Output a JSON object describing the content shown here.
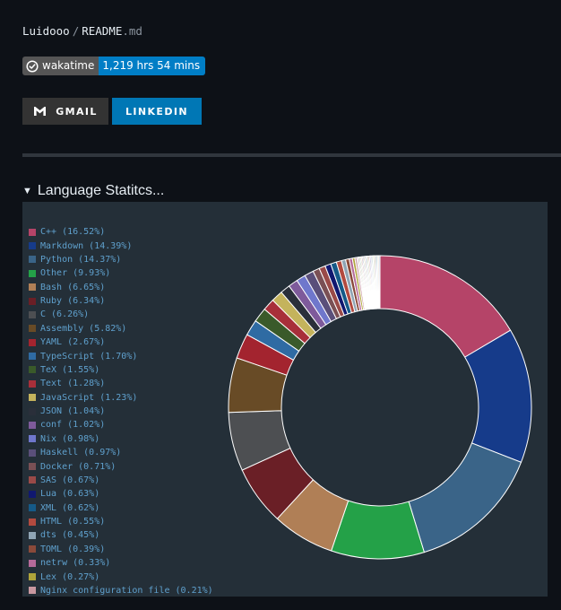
{
  "breadcrumb": {
    "owner": "Luidooo",
    "separator": "/",
    "file_name": "README",
    "file_ext": ".md"
  },
  "badge": {
    "label": "wakatime",
    "value": "1,219 hrs 54 mins",
    "icon": "wakatime-clock-icon",
    "label_color": "#555555",
    "value_color": "#007ec6"
  },
  "buttons": {
    "gmail": {
      "label": "GMAIL",
      "icon": "gmail-icon",
      "color": "#333333"
    },
    "linkedin": {
      "label": "LINKEDIN",
      "color": "#0077b5"
    }
  },
  "section": {
    "title": "Language Statitcs...",
    "toggle_icon": "triangle-down-icon"
  },
  "chart_data": {
    "type": "pie",
    "donut": true,
    "legend_position": "left",
    "categories": [
      "C++",
      "Markdown",
      "Python",
      "Other",
      "Bash",
      "Ruby",
      "C",
      "Assembly",
      "YAML",
      "TypeScript",
      "TeX",
      "Text",
      "JavaScript",
      "JSON",
      "conf",
      "Nix",
      "Haskell",
      "Docker",
      "SAS",
      "Lua",
      "XML",
      "HTML",
      "dts",
      "TOML",
      "netrw",
      "Lex",
      "Nginx configuration file"
    ],
    "values": [
      16.52,
      14.39,
      14.37,
      9.93,
      6.65,
      6.34,
      6.26,
      5.82,
      2.67,
      1.7,
      1.55,
      1.28,
      1.23,
      1.04,
      1.02,
      0.98,
      0.97,
      0.71,
      0.67,
      0.63,
      0.62,
      0.55,
      0.45,
      0.39,
      0.33,
      0.27,
      0.21
    ],
    "legend_labels": [
      "C++ (16.52%)",
      "Markdown (14.39%)",
      "Python (14.37%)",
      "Other (9.93%)",
      "Bash (6.65%)",
      "Ruby (6.34%)",
      "C (6.26%)",
      "Assembly (5.82%)",
      "YAML (2.67%)",
      "TypeScript (1.70%)",
      "TeX (1.55%)",
      "Text (1.28%)",
      "JavaScript (1.23%)",
      "JSON (1.04%)",
      "conf (1.02%)",
      "Nix (0.98%)",
      "Haskell (0.97%)",
      "Docker (0.71%)",
      "SAS (0.67%)",
      "Lua (0.63%)",
      "XML (0.62%)",
      "HTML (0.55%)",
      "dts (0.45%)",
      "TOML (0.39%)",
      "netrw (0.33%)",
      "Lex (0.27%)",
      "Nginx configuration file (0.21%)"
    ],
    "colors": [
      "#b54468",
      "#163b8a",
      "#3a6488",
      "#24a148",
      "#b07f56",
      "#6a1f26",
      "#4d4f52",
      "#684b26",
      "#a3242f",
      "#2f6ba3",
      "#3a5a2a",
      "#a82f3a",
      "#c4b35c",
      "#2a2f3a",
      "#7e5a9b",
      "#6f77cc",
      "#5a4f7a",
      "#7a5055",
      "#9a4a48",
      "#101870",
      "#155a88",
      "#b24a3f",
      "#8fa4b4",
      "#8a4a3a",
      "#b56a9a",
      "#b0a43a",
      "#c898a0"
    ],
    "tail_colors": [
      "#7a5a9a",
      "#9a7a3a",
      "#5a8a6a",
      "#b5b07a",
      "#a05a7a",
      "#6a8aa0",
      "#c0a060",
      "#4a6a9a",
      "#9a9a9a",
      "#7aa05a",
      "#b05050",
      "#5050a0",
      "#a0a0c0",
      "#80b0b0",
      "#c0c080",
      "#6a6a3a",
      "#aa88cc",
      "#3a8a8a",
      "#cc8866",
      "#88aacc"
    ]
  }
}
